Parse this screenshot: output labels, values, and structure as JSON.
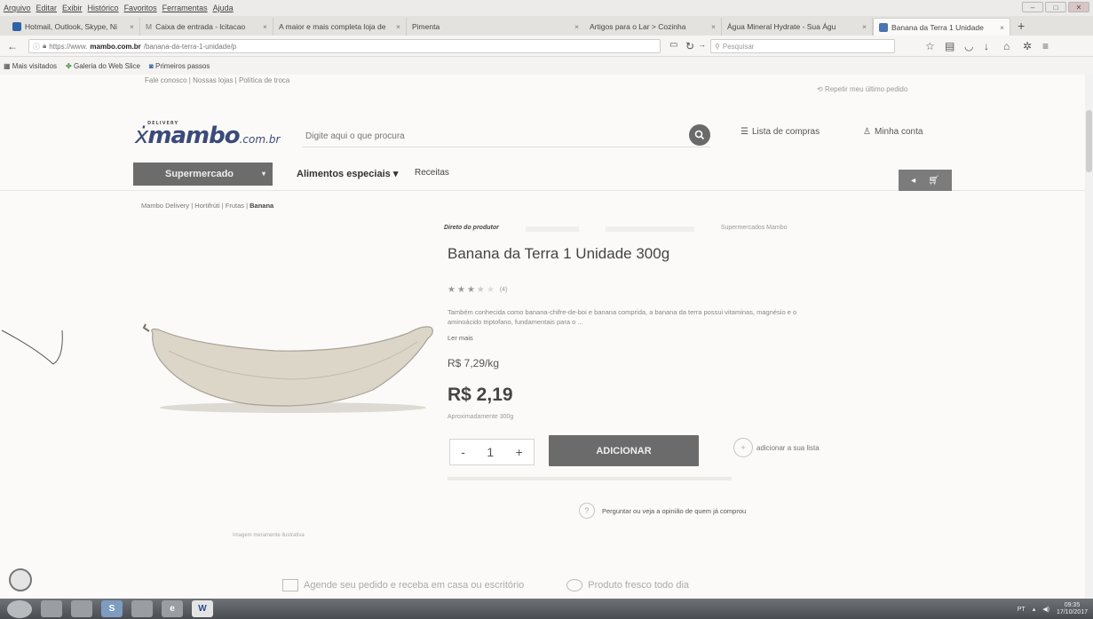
{
  "menubar": {
    "items": [
      "Arquivo",
      "Editar",
      "Exibir",
      "Histórico",
      "Favoritos",
      "Ferramentas",
      "Ajuda"
    ]
  },
  "window_controls": [
    "–",
    "□",
    "✕"
  ],
  "tabs": [
    {
      "label": "Hotmail, Outlook, Skype, Ni"
    },
    {
      "label": "Caixa de entrada - lcitacao"
    },
    {
      "label": "A maior e mais completa loja de"
    },
    {
      "label": "Pimenta"
    },
    {
      "label": "Artigos para o Lar > Cozinha"
    },
    {
      "label": "Água Mineral Hydrate - Sua Águ"
    },
    {
      "label": "Banana da Terra 1 Unidade"
    }
  ],
  "new_tab": "+",
  "address": {
    "prefix": "https://www.",
    "domain": "mambo.com.br",
    "path": "/banana-da-terra-1-unidade/p"
  },
  "browser_search": {
    "placeholder": "Pesquisar"
  },
  "bookmarks": [
    "Mais visitados",
    "Galeria do Web Slice",
    "Primeiros passos"
  ],
  "site": {
    "top_links": "Fale conosco  |  Nossas lojas  |  Política de troca",
    "reorder": "Repetir meu último pedido",
    "logo": {
      "delivery": "DELIVERY",
      "main": "mambo",
      "suffix": ".com.br"
    },
    "search_placeholder": "Digite aqui o que procura",
    "shopping_list": "Lista de compras",
    "my_account": "Minha conta"
  },
  "categories": {
    "supermercado": "Supermercado",
    "caret": "▾",
    "especiais": "Alimentos especiais ▾",
    "receitas": "Receitas"
  },
  "breadcrumb": {
    "path": "Mambo Delivery  |  Hortifrúti  |  Frutas  |",
    "current": "Banana"
  },
  "product": {
    "tag_first": "Direto do produtor",
    "tag_last": "Supermercados Mambo",
    "title": "Banana da Terra 1 Unidade 300g",
    "stars": 3.5,
    "star_count": "(4)",
    "description": "Também conhecida como banana-chifre-de-boi e banana comprida, a banana da terra possui vitaminas, magnésio e o aminoácido triptofano, fundamentais para o ...",
    "read_more": "Ler mais",
    "price_per_kg": "R$ 7,29/kg",
    "price": "R$ 2,19",
    "weight_note": "Aproximadamente 300g",
    "qty_minus": "-",
    "quantity": "1",
    "qty_plus": "+",
    "add_button": "ADICIONAR",
    "add_to_list": "adicionar a sua lista",
    "ask": "Perguntar ou veja a opinião de quem já comprou",
    "image_credit": "Imagem meramente ilustrativa"
  },
  "features": [
    "Agende seu pedido e receba em casa ou escritório",
    "Produto fresco todo dia"
  ],
  "taskbar": {
    "apps": [
      "",
      "",
      "",
      "S",
      "",
      "e",
      "W"
    ],
    "lang": "PT",
    "time": "09:35",
    "date": "17/10/2017"
  }
}
